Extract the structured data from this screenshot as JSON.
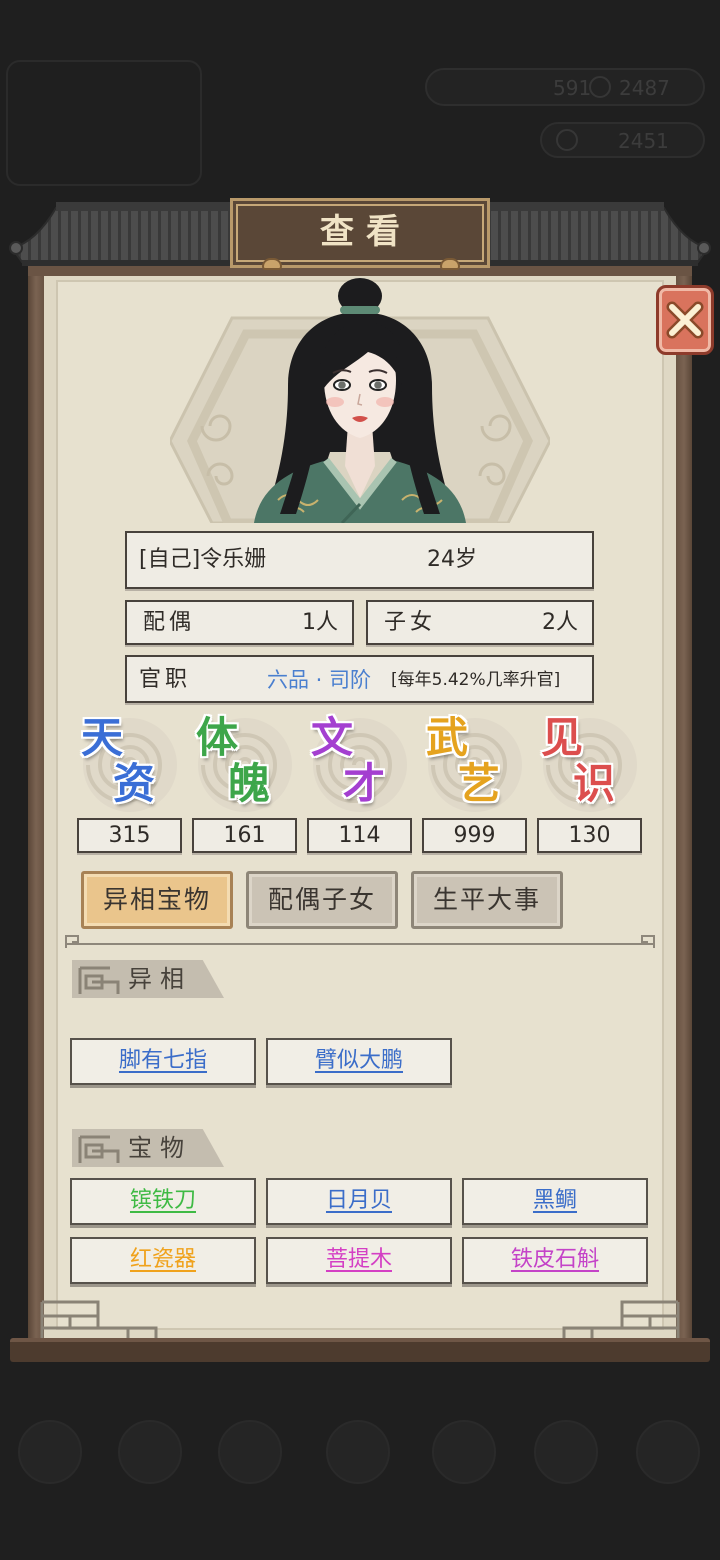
{
  "background": {
    "currency_a": "591",
    "currency_b": "2487",
    "currency_c": "2451"
  },
  "dialog": {
    "title": "查看",
    "close_icon": "close-icon"
  },
  "profile": {
    "portrait_icon": "character-portrait",
    "name": "[自己]令乐姗",
    "age": "24岁",
    "spouse": {
      "label": "配偶",
      "value": "1人"
    },
    "children": {
      "label": "子女",
      "value": "2人"
    },
    "office": {
      "label": "官职",
      "rank": "六品 · 司阶",
      "rank_color": "#4a7fcf",
      "promotion": "[每年5.42%几率升官]"
    }
  },
  "stats": [
    {
      "name": "天资",
      "value": 315,
      "color": "#3a6ed6"
    },
    {
      "name": "体魄",
      "value": 161,
      "color": "#3da64a"
    },
    {
      "name": "文才",
      "value": 114,
      "color": "#a43fd0"
    },
    {
      "name": "武艺",
      "value": 999,
      "color": "#e5a31f"
    },
    {
      "name": "见识",
      "value": 130,
      "color": "#dc4e4e"
    }
  ],
  "tabs": [
    {
      "label": "异相宝物",
      "active": true
    },
    {
      "label": "配偶子女",
      "active": false
    },
    {
      "label": "生平大事",
      "active": false
    }
  ],
  "traits": {
    "title": "异相",
    "items": [
      {
        "label": "脚有七指",
        "color": "#3b6dc9"
      },
      {
        "label": "臂似大鹏",
        "color": "#3b6dc9"
      }
    ]
  },
  "treasures": {
    "title": "宝物",
    "items": [
      {
        "label": "镔铁刀",
        "color": "#3fba44"
      },
      {
        "label": "日月贝",
        "color": "#3b6dc9"
      },
      {
        "label": "黑鲷",
        "color": "#3b6dc9"
      },
      {
        "label": "红瓷器",
        "color": "#f0a21c"
      },
      {
        "label": "菩提木",
        "color": "#d43fc4"
      },
      {
        "label": "铁皮石斛",
        "color": "#c443c8"
      }
    ]
  }
}
